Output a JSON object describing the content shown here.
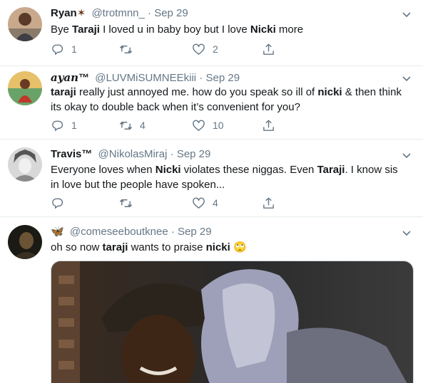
{
  "colors": {
    "text": "#14171a",
    "muted": "#657786",
    "divider": "#e6ecf0"
  },
  "tweets": [
    {
      "name": "Ryan",
      "name_suffix": "✶",
      "handle": "@trotmnn_",
      "sep": "·",
      "date": "Sep 29",
      "text_parts": [
        "Bye ",
        "Taraji",
        " I loved u in baby boy but I love ",
        "Nicki",
        " more"
      ],
      "replies": "1",
      "retweets": "",
      "likes": "2"
    },
    {
      "name": "𝒂𝒚𝒂𝒏",
      "name_suffix": "™",
      "handle": "@LUVMiSUMNEEkiii",
      "sep": "·",
      "date": "Sep 29",
      "text_parts": [
        "taraji",
        " really just annoyed me. how do you speak so ill of ",
        "nicki",
        " & then think its okay to double back when it’s convenient for you?"
      ],
      "replies": "1",
      "retweets": "4",
      "likes": "10"
    },
    {
      "name": "Travis™",
      "name_suffix": "",
      "handle": "@NikolasMiraj",
      "sep": "·",
      "date": "Sep 29",
      "text_parts": [
        "Everyone loves when ",
        "Nicki",
        " violates these niggas. Even ",
        "Taraji",
        ". I know sis in love but the people have spoken..."
      ],
      "replies": "",
      "retweets": "",
      "likes": "4"
    },
    {
      "name": "🦋",
      "name_suffix": "",
      "handle": "@comeseeboutknee",
      "sep": "·",
      "date": "Sep 29",
      "text_parts": [
        "oh so now ",
        "taraji",
        " wants to praise ",
        "nicki",
        " 🙄"
      ]
    }
  ]
}
